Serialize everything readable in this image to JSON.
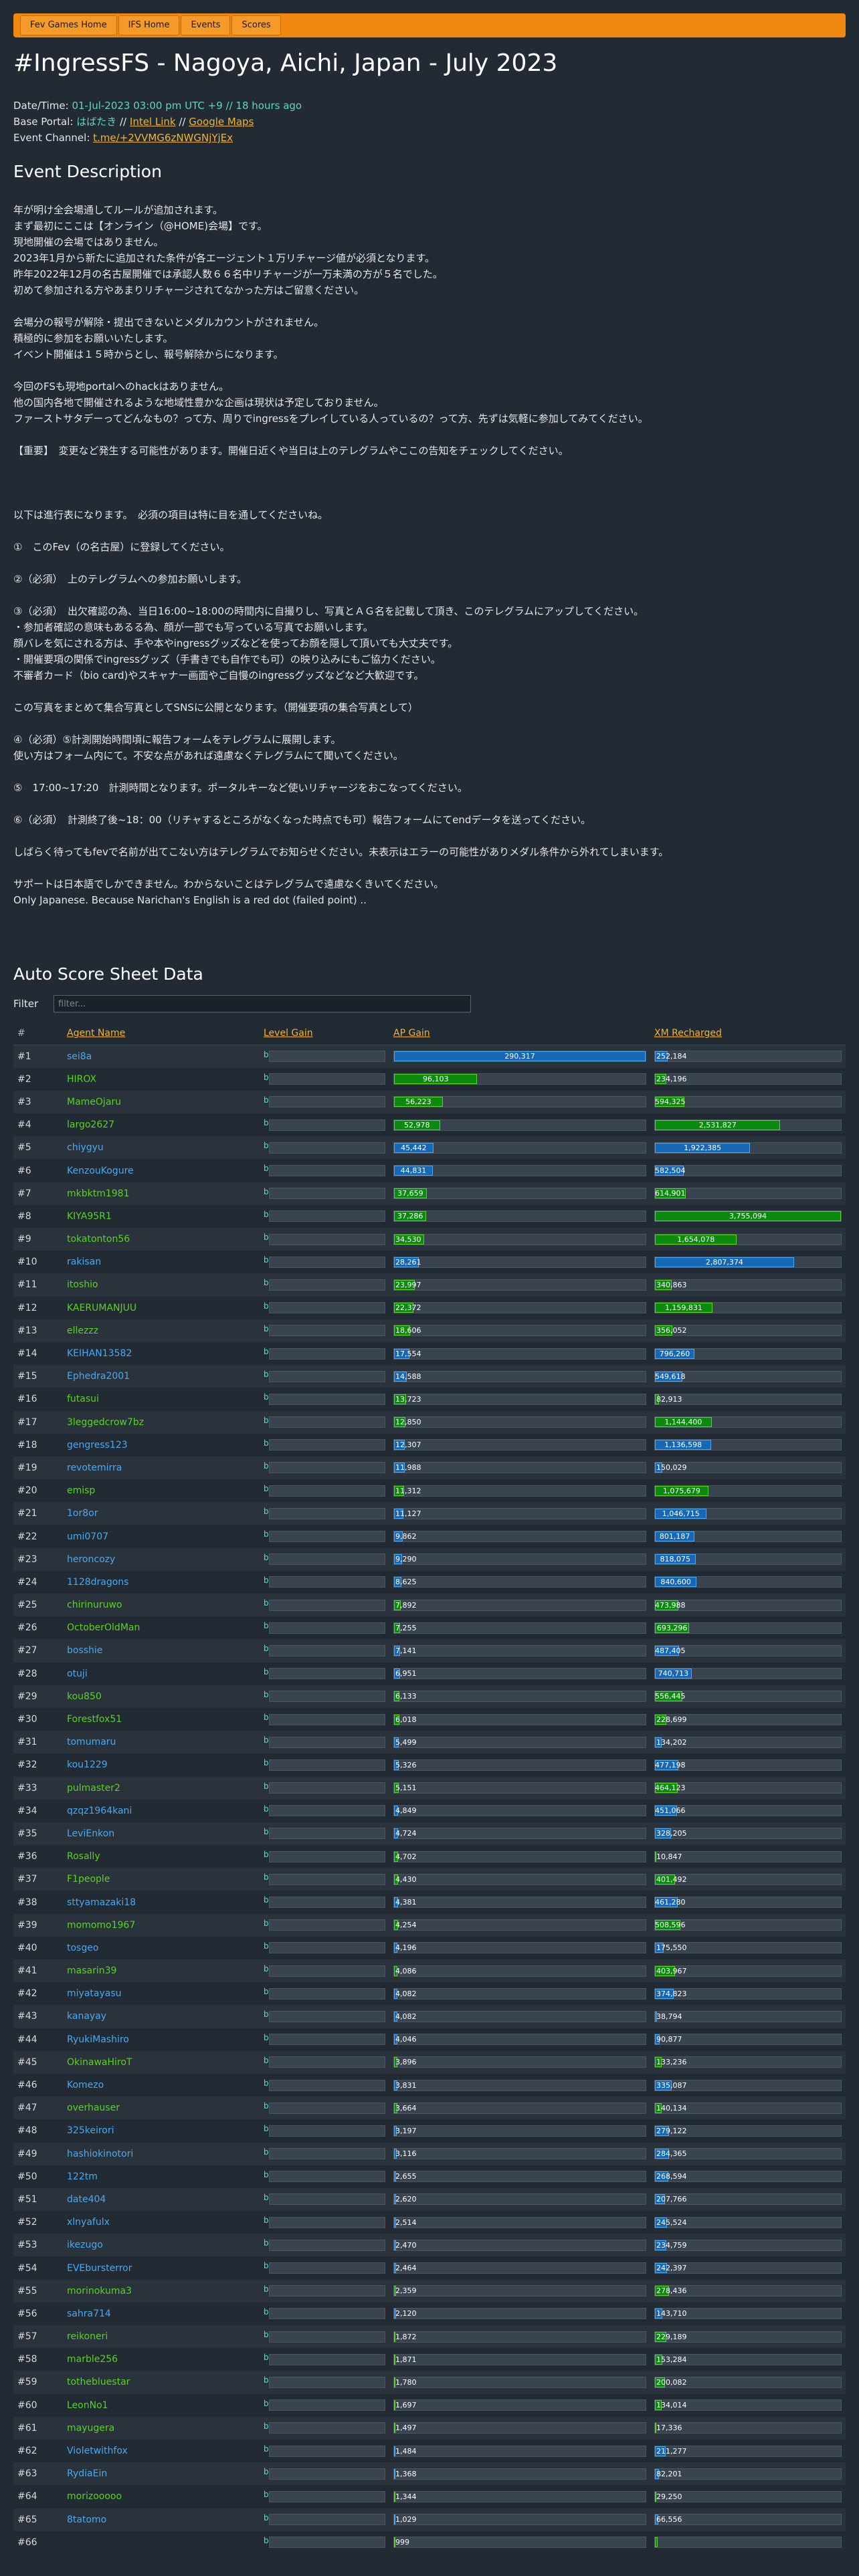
{
  "nav": [
    "Fev Games Home",
    "IFS Home",
    "Events",
    "Scores"
  ],
  "title": "#IngressFS - Nagoya, Aichi, Japan - July 2023",
  "meta": {
    "datetime_label": "Date/Time: ",
    "datetime_value": "01-Jul-2023 03:00 pm UTC +9",
    "datetime_sep": " // ",
    "datetime_ago": "18 hours ago",
    "portal_label": "Base Portal: ",
    "portal_name": "はばたき",
    "portal_sep1": " // ",
    "portal_intel": "Intel Link",
    "portal_sep2": " // ",
    "portal_maps": "Google Maps",
    "channel_label": "Event Channel: ",
    "channel_link": "t.me/+2VVMG6zNWGNjYjEx"
  },
  "description_heading": "Event Description",
  "description_lines": [
    "年が明け全会場通してルールが追加されます。",
    "まず最初にここは【オンライン（@HOME)会場】です。",
    "現地開催の会場ではありません。",
    "2023年1月から新たに追加された条件が各エージェント１万リチャージ値が必須となります。",
    "昨年2022年12月の名古屋開催では承認人数６６名中リチャージが一万未満の方が５名でした。",
    "初めて参加される方やあまりリチャージされてなかった方はご留意ください。",
    "",
    "会場分の報号が解除・提出できないとメダルカウントがされません。",
    "積極的に参加をお願いいたします。",
    "イベント開催は１５時からとし、報号解除からになります。",
    "",
    "今回のFSも現地portalへのhackはありません。",
    "他の国内各地で開催されるような地域性豊かな企画は現状は予定しておりません。",
    "ファーストサタデーってどんなもの？って方、周りでingressをプレイしている人っているの？って方、先ずは気軽に参加してみてください。",
    "",
    "【重要】　変更など発生する可能性があります。開催日近くや当日は上のテレグラムやここの告知をチェックしてください。",
    "",
    "",
    "",
    "以下は進行表になります。　必須の項目は特に目を通してくださいね。",
    "",
    "①　このFev（の名古屋）に登録してください。",
    "",
    "②（必須）　上のテレグラムへの参加お願いします。",
    "",
    "③（必須）　出欠確認の為、当日16:00~18:00の時間内に自撮りし、写真とＡＧ名を記載して頂き、このテレグラムにアップしてください。",
    "・参加者確認の意味もあるる為、顔が一部でも写っている写真でお願いします。",
    "顔バレを気にされる方は、手や本やingressグッズなどを使ってお顔を隠して頂いても大丈夫です。",
    "・開催要項の関係でingressグッズ（手書きでも自作でも可）の映り込みにもご協力ください。",
    "不審者カード（bio card)やスキャナー画面やご自慢のingressグッズなどなど大歓迎です。",
    "",
    "この写真をまとめて集合写真としてSNSに公開となります。（開催要項の集合写真として）",
    "",
    "④（必須）⑤計測開始時間頃に報告フォームをテレグラムに展開します。",
    "使い方はフォーム内にて。不安な点があれば遠慮なくテレグラムにて聞いてください。",
    "",
    "⑤　17:00~17:20　計測時間となります。ポータルキーなど使いリチャージをおこなってください。",
    "",
    "⑥（必須）　計測終了後~18：00（リチャするところがなくなった時点でも可）報告フォームにてendデータを送ってください。",
    "",
    "しばらく待ってもfevで名前が出てこない方はテレグラムでお知らせください。未表示はエラーの可能性がありメダル条件から外れてしまいます。",
    "",
    "サポートは日本語でしかできません。わからないことはテレグラムで遠慮なくきいてください。",
    "Only Japanese. Because Narichan's English is a red dot (failed point) .."
  ],
  "score_heading": "Auto Score Sheet Data",
  "filter": {
    "label": "Filter",
    "placeholder": "filter..."
  },
  "table": {
    "headers": {
      "rank": "#",
      "agent": "Agent Name",
      "level": "Level Gain",
      "ap": "AP Gain",
      "xm": "XM Recharged"
    },
    "level_value": "b",
    "ap_max": 290317,
    "xm_max": 3755094,
    "colors": {
      "green": "#58d31e",
      "blue": "#4aa8f0",
      "fill_green": "#0c8a10",
      "fill_blue": "#1667b6"
    },
    "rows": [
      {
        "rank": "#1",
        "name": "sei8a",
        "team": "blue",
        "ap": 290317,
        "ap_label": "290,317",
        "xm": 252184,
        "xm_label": "252,184"
      },
      {
        "rank": "#2",
        "name": "HIROX",
        "team": "green",
        "ap": 96103,
        "ap_label": "96,103",
        "xm": 234196,
        "xm_label": "234,196"
      },
      {
        "rank": "#3",
        "name": "MameOjaru",
        "team": "green",
        "ap": 56223,
        "ap_label": "56,223",
        "xm": 594325,
        "xm_label": "594,325"
      },
      {
        "rank": "#4",
        "name": "largo2627",
        "team": "green",
        "ap": 52978,
        "ap_label": "52,978",
        "xm": 2531827,
        "xm_label": "2,531,827"
      },
      {
        "rank": "#5",
        "name": "chiygyu",
        "team": "blue",
        "ap": 45442,
        "ap_label": "45,442",
        "xm": 1922385,
        "xm_label": "1,922,385"
      },
      {
        "rank": "#6",
        "name": "KenzouKogure",
        "team": "blue",
        "ap": 44831,
        "ap_label": "44,831",
        "xm": 582504,
        "xm_label": "582,504"
      },
      {
        "rank": "#7",
        "name": "mkbktm1981",
        "team": "green",
        "ap": 37659,
        "ap_label": "37,659",
        "xm": 614901,
        "xm_label": "614,901"
      },
      {
        "rank": "#8",
        "name": "KIYA95R1",
        "team": "green",
        "ap": 37286,
        "ap_label": "37,286",
        "xm": 3755094,
        "xm_label": "3,755,094"
      },
      {
        "rank": "#9",
        "name": "tokatonton56",
        "team": "green",
        "ap": 34530,
        "ap_label": "34,530",
        "xm": 1654078,
        "xm_label": "1,654,078"
      },
      {
        "rank": "#10",
        "name": "rakisan",
        "team": "blue",
        "ap": 28261,
        "ap_label": "28,261",
        "xm": 2807374,
        "xm_label": "2,807,374"
      },
      {
        "rank": "#11",
        "name": "itoshio",
        "team": "green",
        "ap": 23997,
        "ap_label": "23,997",
        "xm": 340863,
        "xm_label": "340,863"
      },
      {
        "rank": "#12",
        "name": "KAERUMANJUU",
        "team": "green",
        "ap": 22372,
        "ap_label": "22,372",
        "xm": 1159831,
        "xm_label": "1,159,831"
      },
      {
        "rank": "#13",
        "name": "ellezzz",
        "team": "green",
        "ap": 18606,
        "ap_label": "18,606",
        "xm": 356052,
        "xm_label": "356,052"
      },
      {
        "rank": "#14",
        "name": "KEIHAN13582",
        "team": "blue",
        "ap": 17554,
        "ap_label": "17,554",
        "xm": 796260,
        "xm_label": "796,260"
      },
      {
        "rank": "#15",
        "name": "Ephedra2001",
        "team": "blue",
        "ap": 14588,
        "ap_label": "14,588",
        "xm": 549618,
        "xm_label": "549,618"
      },
      {
        "rank": "#16",
        "name": "futasui",
        "team": "green",
        "ap": 13723,
        "ap_label": "13,723",
        "xm": 82913,
        "xm_label": "82,913"
      },
      {
        "rank": "#17",
        "name": "3leggedcrow7bz",
        "team": "green",
        "ap": 12850,
        "ap_label": "12,850",
        "xm": 1144400,
        "xm_label": "1,144,400"
      },
      {
        "rank": "#18",
        "name": "gengress123",
        "team": "blue",
        "ap": 12307,
        "ap_label": "12,307",
        "xm": 1136598,
        "xm_label": "1,136,598"
      },
      {
        "rank": "#19",
        "name": "revotemirra",
        "team": "blue",
        "ap": 11988,
        "ap_label": "11,988",
        "xm": 150029,
        "xm_label": "150,029"
      },
      {
        "rank": "#20",
        "name": "emisp",
        "team": "green",
        "ap": 11312,
        "ap_label": "11,312",
        "xm": 1075679,
        "xm_label": "1,075,679"
      },
      {
        "rank": "#21",
        "name": "1or8or",
        "team": "blue",
        "ap": 11127,
        "ap_label": "11,127",
        "xm": 1046715,
        "xm_label": "1,046,715"
      },
      {
        "rank": "#22",
        "name": "umi0707",
        "team": "blue",
        "ap": 9862,
        "ap_label": "9,862",
        "xm": 801187,
        "xm_label": "801,187"
      },
      {
        "rank": "#23",
        "name": "heroncozy",
        "team": "blue",
        "ap": 9290,
        "ap_label": "9,290",
        "xm": 818075,
        "xm_label": "818,075"
      },
      {
        "rank": "#24",
        "name": "1128dragons",
        "team": "blue",
        "ap": 8625,
        "ap_label": "8,625",
        "xm": 840600,
        "xm_label": "840,600"
      },
      {
        "rank": "#25",
        "name": "chirinuruwo",
        "team": "green",
        "ap": 7892,
        "ap_label": "7,892",
        "xm": 473988,
        "xm_label": "473,988"
      },
      {
        "rank": "#26",
        "name": "OctoberOldMan",
        "team": "green",
        "ap": 7255,
        "ap_label": "7,255",
        "xm": 693296,
        "xm_label": "693,296"
      },
      {
        "rank": "#27",
        "name": "bosshie",
        "team": "blue",
        "ap": 7141,
        "ap_label": "7,141",
        "xm": 487405,
        "xm_label": "487,405"
      },
      {
        "rank": "#28",
        "name": "otuji",
        "team": "blue",
        "ap": 6951,
        "ap_label": "6,951",
        "xm": 740713,
        "xm_label": "740,713"
      },
      {
        "rank": "#29",
        "name": "kou850",
        "team": "green",
        "ap": 6133,
        "ap_label": "6,133",
        "xm": 556445,
        "xm_label": "556,445"
      },
      {
        "rank": "#30",
        "name": "Forestfox51",
        "team": "green",
        "ap": 6018,
        "ap_label": "6,018",
        "xm": 228699,
        "xm_label": "228,699"
      },
      {
        "rank": "#31",
        "name": "tomumaru",
        "team": "blue",
        "ap": 5499,
        "ap_label": "5,499",
        "xm": 134202,
        "xm_label": "134,202"
      },
      {
        "rank": "#32",
        "name": "kou1229",
        "team": "blue",
        "ap": 5326,
        "ap_label": "5,326",
        "xm": 477198,
        "xm_label": "477,198"
      },
      {
        "rank": "#33",
        "name": "pulmaster2",
        "team": "green",
        "ap": 5151,
        "ap_label": "5,151",
        "xm": 464123,
        "xm_label": "464,123"
      },
      {
        "rank": "#34",
        "name": "qzqz1964kani",
        "team": "blue",
        "ap": 4849,
        "ap_label": "4,849",
        "xm": 451066,
        "xm_label": "451,066"
      },
      {
        "rank": "#35",
        "name": "LeviEnkon",
        "team": "blue",
        "ap": 4724,
        "ap_label": "4,724",
        "xm": 328205,
        "xm_label": "328,205"
      },
      {
        "rank": "#36",
        "name": "Rosally",
        "team": "green",
        "ap": 4702,
        "ap_label": "4,702",
        "xm": 10847,
        "xm_label": "10,847"
      },
      {
        "rank": "#37",
        "name": "F1people",
        "team": "green",
        "ap": 4430,
        "ap_label": "4,430",
        "xm": 401492,
        "xm_label": "401,492"
      },
      {
        "rank": "#38",
        "name": "sttyamazaki18",
        "team": "blue",
        "ap": 4381,
        "ap_label": "4,381",
        "xm": 461280,
        "xm_label": "461,280"
      },
      {
        "rank": "#39",
        "name": "momomo1967",
        "team": "green",
        "ap": 4254,
        "ap_label": "4,254",
        "xm": 508596,
        "xm_label": "508,596"
      },
      {
        "rank": "#40",
        "name": "tosgeo",
        "team": "blue",
        "ap": 4196,
        "ap_label": "4,196",
        "xm": 175550,
        "xm_label": "175,550"
      },
      {
        "rank": "#41",
        "name": "masarin39",
        "team": "green",
        "ap": 4086,
        "ap_label": "4,086",
        "xm": 403967,
        "xm_label": "403,967"
      },
      {
        "rank": "#42",
        "name": "miyatayasu",
        "team": "blue",
        "ap": 4082,
        "ap_label": "4,082",
        "xm": 374823,
        "xm_label": "374,823"
      },
      {
        "rank": "#43",
        "name": "kanayay",
        "team": "blue",
        "ap": 4082,
        "ap_label": "4,082",
        "xm": 38794,
        "xm_label": "38,794"
      },
      {
        "rank": "#44",
        "name": "RyukiMashiro",
        "team": "blue",
        "ap": 4046,
        "ap_label": "4,046",
        "xm": 90877,
        "xm_label": "90,877"
      },
      {
        "rank": "#45",
        "name": "OkinawaHiroT",
        "team": "green",
        "ap": 3896,
        "ap_label": "3,896",
        "xm": 133236,
        "xm_label": "133,236"
      },
      {
        "rank": "#46",
        "name": "Komezo",
        "team": "blue",
        "ap": 3831,
        "ap_label": "3,831",
        "xm": 335087,
        "xm_label": "335,087"
      },
      {
        "rank": "#47",
        "name": "overhauser",
        "team": "green",
        "ap": 3664,
        "ap_label": "3,664",
        "xm": 140134,
        "xm_label": "140,134"
      },
      {
        "rank": "#48",
        "name": "325keirori",
        "team": "blue",
        "ap": 3197,
        "ap_label": "3,197",
        "xm": 279122,
        "xm_label": "279,122"
      },
      {
        "rank": "#49",
        "name": "hashiokinotori",
        "team": "blue",
        "ap": 3116,
        "ap_label": "3,116",
        "xm": 284365,
        "xm_label": "284,365"
      },
      {
        "rank": "#50",
        "name": "122tm",
        "team": "blue",
        "ap": 2655,
        "ap_label": "2,655",
        "xm": 268594,
        "xm_label": "268,594"
      },
      {
        "rank": "#51",
        "name": "date404",
        "team": "blue",
        "ap": 2620,
        "ap_label": "2,620",
        "xm": 207766,
        "xm_label": "207,766"
      },
      {
        "rank": "#52",
        "name": "xlnyafulx",
        "team": "blue",
        "ap": 2514,
        "ap_label": "2,514",
        "xm": 245524,
        "xm_label": "245,524"
      },
      {
        "rank": "#53",
        "name": "ikezugo",
        "team": "blue",
        "ap": 2470,
        "ap_label": "2,470",
        "xm": 234759,
        "xm_label": "234,759"
      },
      {
        "rank": "#54",
        "name": "EVEbursterror",
        "team": "blue",
        "ap": 2464,
        "ap_label": "2,464",
        "xm": 242397,
        "xm_label": "242,397"
      },
      {
        "rank": "#55",
        "name": "morinokuma3",
        "team": "green",
        "ap": 2359,
        "ap_label": "2,359",
        "xm": 278436,
        "xm_label": "278,436"
      },
      {
        "rank": "#56",
        "name": "sahra714",
        "team": "blue",
        "ap": 2120,
        "ap_label": "2,120",
        "xm": 143710,
        "xm_label": "143,710"
      },
      {
        "rank": "#57",
        "name": "reikoneri",
        "team": "green",
        "ap": 1872,
        "ap_label": "1,872",
        "xm": 229189,
        "xm_label": "229,189"
      },
      {
        "rank": "#58",
        "name": "marble256",
        "team": "green",
        "ap": 1871,
        "ap_label": "1,871",
        "xm": 153284,
        "xm_label": "153,284"
      },
      {
        "rank": "#59",
        "name": "tothebluestar",
        "team": "green",
        "ap": 1780,
        "ap_label": "1,780",
        "xm": 200082,
        "xm_label": "200,082"
      },
      {
        "rank": "#60",
        "name": "LeonNo1",
        "team": "green",
        "ap": 1697,
        "ap_label": "1,697",
        "xm": 134014,
        "xm_label": "134,014"
      },
      {
        "rank": "#61",
        "name": "mayugera",
        "team": "green",
        "ap": 1497,
        "ap_label": "1,497",
        "xm": 17336,
        "xm_label": "17,336"
      },
      {
        "rank": "#62",
        "name": "Violetwithfox",
        "team": "blue",
        "ap": 1484,
        "ap_label": "1,484",
        "xm": 211277,
        "xm_label": "211,277"
      },
      {
        "rank": "#63",
        "name": "RydiaEin",
        "team": "blue",
        "ap": 1368,
        "ap_label": "1,368",
        "xm": 82201,
        "xm_label": "82,201"
      },
      {
        "rank": "#64",
        "name": "morizooooo",
        "team": "green",
        "ap": 1344,
        "ap_label": "1,344",
        "xm": 29250,
        "xm_label": "29,250"
      },
      {
        "rank": "#65",
        "name": "8tatomo",
        "team": "blue",
        "ap": 1029,
        "ap_label": "1,029",
        "xm": 66556,
        "xm_label": "66,556"
      },
      {
        "rank": "#66",
        "name": "",
        "team": "green",
        "ap": 999,
        "ap_label": "999",
        "xm": 60000,
        "xm_label": ""
      }
    ]
  }
}
